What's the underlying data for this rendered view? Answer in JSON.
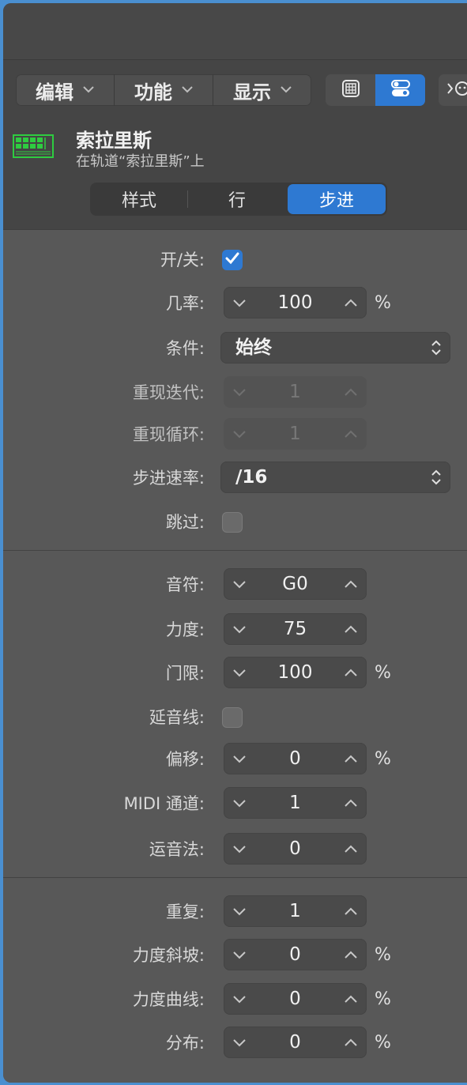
{
  "toolbar": {
    "menus": [
      {
        "label": "编辑"
      },
      {
        "label": "功能"
      },
      {
        "label": "显示"
      }
    ]
  },
  "track": {
    "name": "索拉里斯",
    "subtitle": "在轨道“索拉里斯”上"
  },
  "mode_tabs": [
    {
      "label": "样式",
      "active": false
    },
    {
      "label": "行",
      "active": false
    },
    {
      "label": "步进",
      "active": true
    }
  ],
  "step_settings": {
    "on_off": {
      "label": "开/关:",
      "checked": true
    },
    "probability": {
      "label": "几率:",
      "value": "100",
      "unit": "%"
    },
    "condition": {
      "label": "条件:",
      "value": "始终"
    },
    "repeat_iteration": {
      "label": "重现迭代:",
      "value": "1",
      "enabled": false
    },
    "repeat_loop": {
      "label": "重现循环:",
      "value": "1",
      "enabled": false
    },
    "step_rate": {
      "label": "步进速率:",
      "value": "/16"
    },
    "skip": {
      "label": "跳过:",
      "checked": false
    }
  },
  "note_settings": {
    "note": {
      "label": "音符:",
      "value": "G0"
    },
    "velocity": {
      "label": "力度:",
      "value": "75"
    },
    "gate": {
      "label": "门限:",
      "value": "100",
      "unit": "%"
    },
    "tie": {
      "label": "延音线:",
      "checked": false
    },
    "offset": {
      "label": "偏移:",
      "value": "0",
      "unit": "%"
    },
    "midi_channel": {
      "label": "MIDI 通道:",
      "value": "1"
    },
    "articulation": {
      "label": "运音法:",
      "value": "0"
    }
  },
  "repeat_settings": {
    "repeat": {
      "label": "重复:",
      "value": "1"
    },
    "velocity_ramp": {
      "label": "力度斜坡:",
      "value": "0",
      "unit": "%"
    },
    "velocity_curve": {
      "label": "力度曲线:",
      "value": "0",
      "unit": "%"
    },
    "distribution": {
      "label": "分布:",
      "value": "0",
      "unit": "%"
    }
  },
  "colors": {
    "accent": "#2e79d2",
    "track_icon": "#2ecc40",
    "background": "#585858",
    "toolbar": "#454545"
  },
  "icons": {
    "chevron_down": "chevron-down-icon",
    "chevron_up": "chevron-up-icon",
    "checkmark": "checkmark-icon",
    "updown": "updown-arrows-icon",
    "piano_roll": "piano-roll-icon",
    "inspector": "inspector-icon",
    "track_grid": "step-sequencer-grid-icon"
  }
}
